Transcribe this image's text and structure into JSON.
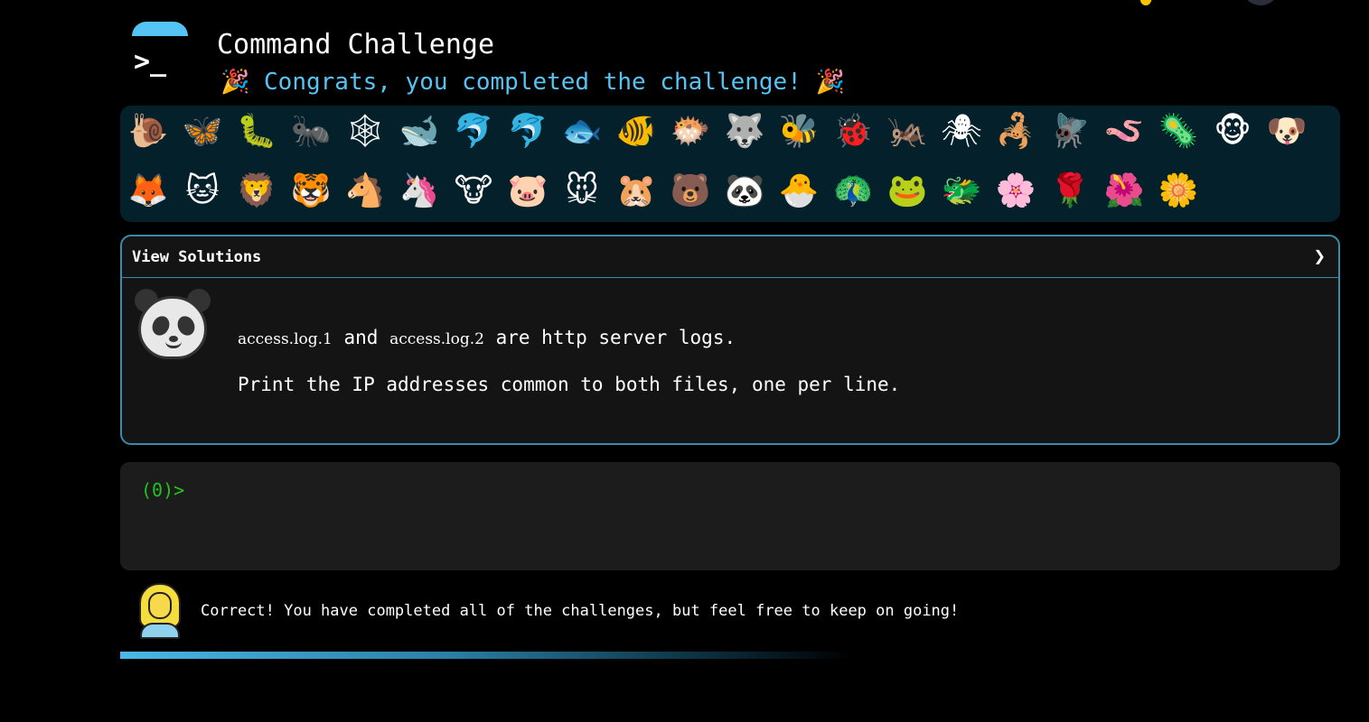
{
  "header": {
    "title": "Command Challenge",
    "congrats": "🎉 Congrats, you completed the challenge! 🎉"
  },
  "animals": [
    "🐌",
    "🦋",
    "🐛",
    "🐜",
    "🕸",
    "🐋",
    "🐬",
    "🐬",
    "🐟",
    "🐠",
    "🐡",
    "🐺",
    "🐝",
    "🐞",
    "🦗",
    "🕷",
    "🦂",
    "🪰",
    "🪱",
    "🦠",
    "🐵",
    "🐶",
    "🦊",
    "🐱",
    "🦁",
    "🐯",
    "🐴",
    "🦄",
    "🐮",
    "🐷",
    "🐭",
    "🐹",
    "🐻",
    "🐼",
    "🐣",
    "🦚",
    "🐸",
    "🐲",
    "🌸",
    "🌹",
    "🌺",
    "🌼"
  ],
  "solutions": {
    "title": "View Solutions",
    "chevron": "❯",
    "file1": "access.log.1",
    "and": " and ",
    "file2": "access.log.2",
    "tail": " are http server logs.",
    "line2": "Print the IP addresses common to both files, one per line."
  },
  "terminal": {
    "prompt": "(0)>"
  },
  "feedback": {
    "message": "Correct! You have completed all of the challenges, but feel free to keep on going!"
  },
  "colors": {
    "accent": "#55c4f5",
    "prompt": "#22c41e",
    "panel_border": "#3a8bab"
  }
}
